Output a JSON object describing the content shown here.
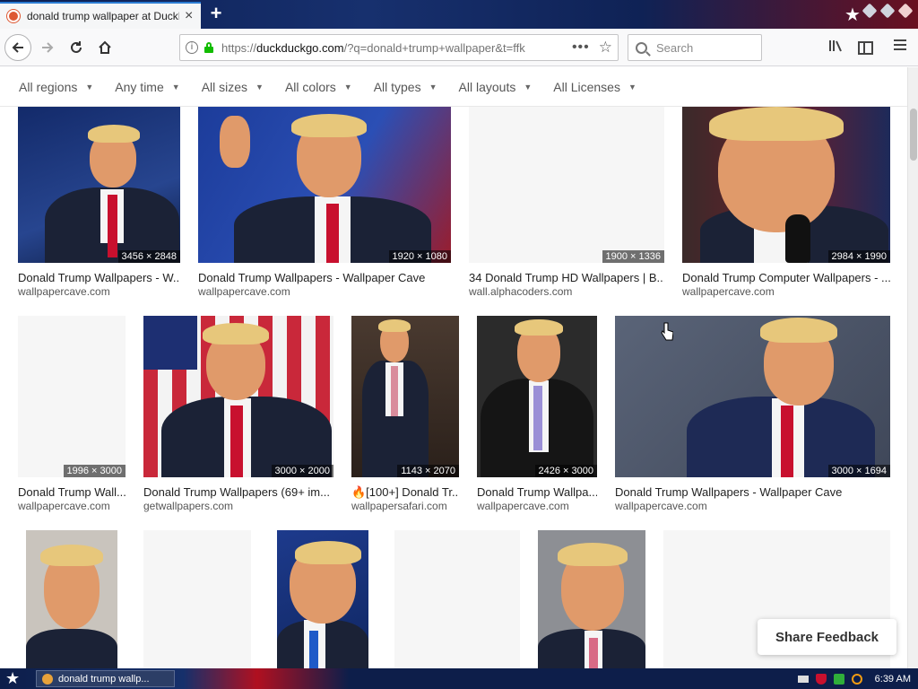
{
  "browser": {
    "tab": {
      "title": "donald trump wallpaper at DuckDuckGo",
      "close": "×"
    },
    "new_tab": "+",
    "url": {
      "prefix": "https://",
      "domain": "duckduckgo.com",
      "path": "/?q=donald+trump+wallpaper&t=ffk"
    },
    "url_actions": "•••",
    "search_placeholder": "Search",
    "toolbar_icons": [
      "library-icon",
      "sidebar-icon",
      "menu-icon"
    ]
  },
  "filters": [
    "All regions",
    "Any time",
    "All sizes",
    "All colors",
    "All types",
    "All layouts",
    "All Licenses"
  ],
  "results": {
    "row1": [
      {
        "title": "Donald Trump Wallpapers - W...",
        "source": "wallpapercave.com",
        "dims": "3456 × 2848"
      },
      {
        "title": "Donald Trump Wallpapers - Wallpaper Cave",
        "source": "wallpapercave.com",
        "dims": "1920 × 1080"
      },
      {
        "title": "34 Donald Trump HD Wallpapers | B...",
        "source": "wall.alphacoders.com",
        "dims": "1900 × 1336"
      },
      {
        "title": "Donald Trump Computer Wallpapers - ...",
        "source": "wallpapercave.com",
        "dims": "2984 × 1990"
      }
    ],
    "row2": [
      {
        "title": "Donald Trump Wall...",
        "source": "wallpapercave.com",
        "dims": "1996 × 3000"
      },
      {
        "title": "Donald Trump Wallpapers (69+ im...",
        "source": "getwallpapers.com",
        "dims": "3000 × 2000"
      },
      {
        "title": "🔥[100+] Donald Tr...",
        "source": "wallpapersafari.com",
        "dims": "1143 × 2070"
      },
      {
        "title": "Donald Trump Wallpa...",
        "source": "wallpapercave.com",
        "dims": "2426 × 3000"
      },
      {
        "title": "Donald Trump Wallpapers - Wallpaper Cave",
        "source": "wallpapercave.com",
        "dims": "3000 × 1694"
      }
    ]
  },
  "feedback_label": "Share Feedback",
  "taskbar": {
    "task_label": "donald trump wallp...",
    "clock": "6:39 AM"
  },
  "colors": {
    "accent": "#de5833",
    "lock": "#12bc00",
    "tie": "#c8102e",
    "suit": "#1b2236"
  }
}
